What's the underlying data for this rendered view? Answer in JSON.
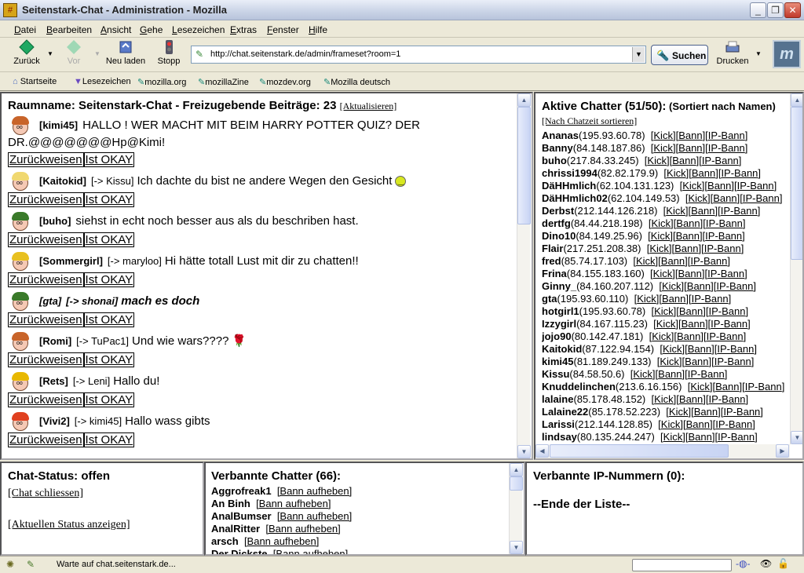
{
  "window": {
    "title": "Seitenstark-Chat - Administration - Mozilla"
  },
  "menu": [
    "Datei",
    "Bearbeiten",
    "Ansicht",
    "Gehe",
    "Lesezeichen",
    "Extras",
    "Fenster",
    "Hilfe"
  ],
  "nav": {
    "back": "Zurück",
    "forward": "Vor",
    "reload": "Neu laden",
    "stop": "Stopp",
    "url": "http://chat.seitenstark.de/admin/frameset?room=1",
    "search": "Suchen",
    "print": "Drucken"
  },
  "bookmarks": [
    "Startseite",
    "Lesezeichen",
    "mozilla.org",
    "mozillaZine",
    "mozdev.org",
    "Mozilla deutsch"
  ],
  "chat": {
    "heading": "Raumname: Seitenstark-Chat - Freizugebende Beiträge: 23",
    "refresh": "[Aktualisieren]",
    "reject": "Zurückweisen",
    "ok": "Ist OKAY",
    "messages": [
      {
        "user": "[kimi45]",
        "to": "",
        "text": "HALLO ! WER MACHT MIT BEIM HARRY POTTER QUIZ? DER",
        "cont": "DR.@@@@@@@Hp@Kimi!",
        "hair": "#c8642a",
        "style": "normal",
        "emoji": ""
      },
      {
        "user": "[Kaitokid]",
        "to": "[-> Kissu]",
        "text": "Ich dachte du bist ne andere Wegen den Gesicht",
        "cont": "",
        "hair": "#f0d870",
        "style": "normal",
        "emoji": "smiley"
      },
      {
        "user": "[buho]",
        "to": "",
        "text": "siehst in echt noch besser aus als du beschriben hast.",
        "cont": "",
        "hair": "#3a7a2a",
        "style": "normal",
        "emoji": ""
      },
      {
        "user": "[Sommergirl]",
        "to": "[-> maryloo]",
        "text": "Hi hätte totall Lust mit dir zu chatten!!",
        "cont": "",
        "hair": "#e8c020",
        "style": "normal",
        "emoji": ""
      },
      {
        "user": "[gta]",
        "to": "[-> shonai]",
        "text": "mach es doch",
        "cont": "",
        "hair": "#3a7a2a",
        "style": "bolditalic",
        "emoji": ""
      },
      {
        "user": "[Romi]",
        "to": "[-> TuPac1]",
        "text": "Und wie wars????",
        "cont": "",
        "hair": "#c8642a",
        "style": "normal",
        "emoji": "rose"
      },
      {
        "user": "[Rets]",
        "to": "[-> Leni]",
        "text": "Hallo du!",
        "cont": "",
        "hair": "#e8b800",
        "style": "normal",
        "emoji": ""
      },
      {
        "user": "[Vivi2]",
        "to": "[-> kimi45]",
        "text": "Hallo wass gibts",
        "cont": "",
        "hair": "#e04020",
        "style": "normal",
        "emoji": ""
      }
    ]
  },
  "active": {
    "heading": "Aktive Chatter (51/50):",
    "sort": "(Sortiert nach Namen)",
    "sort_link": "[Nach Chatzeit sortieren]",
    "kick": "Kick",
    "bann": "Bann",
    "ipbann": "IP-Bann",
    "users": [
      {
        "name": "Ananas",
        "ip": "(195.93.60.78)"
      },
      {
        "name": "Banny",
        "ip": "(84.148.187.86)"
      },
      {
        "name": "buho",
        "ip": "(217.84.33.245)"
      },
      {
        "name": "chrissi1994",
        "ip": "(82.82.179.9)"
      },
      {
        "name": "DäHHmlich",
        "ip": "(62.104.131.123)"
      },
      {
        "name": "DäHHmlich02",
        "ip": "(62.104.149.53)"
      },
      {
        "name": "Derbst",
        "ip": "(212.144.126.218)"
      },
      {
        "name": "dertfg",
        "ip": "(84.44.218.198)"
      },
      {
        "name": "Dino10",
        "ip": "(84.149.25.96)"
      },
      {
        "name": "Flair",
        "ip": "(217.251.208.38)"
      },
      {
        "name": "fred",
        "ip": "(85.74.17.103)"
      },
      {
        "name": "Frina",
        "ip": "(84.155.183.160)"
      },
      {
        "name": "Ginny_",
        "ip": "(84.160.207.112)"
      },
      {
        "name": "gta",
        "ip": "(195.93.60.110)"
      },
      {
        "name": "hotgirl1",
        "ip": "(195.93.60.78)"
      },
      {
        "name": "Izzygirl",
        "ip": "(84.167.115.23)"
      },
      {
        "name": "jojo90",
        "ip": "(80.142.47.181)"
      },
      {
        "name": "Kaitokid",
        "ip": "(87.122.94.154)"
      },
      {
        "name": "kimi45",
        "ip": "(81.189.249.133)"
      },
      {
        "name": "Kissu",
        "ip": "(84.58.50.6)"
      },
      {
        "name": "Knuddelinchen",
        "ip": "(213.6.16.156)"
      },
      {
        "name": "lalaine",
        "ip": "(85.178.48.152)"
      },
      {
        "name": "Lalaine22",
        "ip": "(85.178.52.223)"
      },
      {
        "name": "Larissi",
        "ip": "(212.144.128.85)"
      },
      {
        "name": "lindsay",
        "ip": "(80.135.244.247)"
      }
    ]
  },
  "status": {
    "heading": "Chat-Status: offen",
    "close": "[Chat schliessen]",
    "show": "[Aktuellen Status anzeigen]"
  },
  "banned": {
    "heading": "Verbannte Chatter (66):",
    "unban": "[Bann aufheben]",
    "users": [
      "Aggrofreak1",
      "An Binh",
      "AnalBumser",
      "AnalRitter",
      "arsch",
      "Der Dickste"
    ]
  },
  "ipban": {
    "heading": "Verbannte IP-Nummern (0):",
    "end": "--Ende der Liste--"
  },
  "statusbar": {
    "text": "Warte auf chat.seitenstark.de..."
  }
}
